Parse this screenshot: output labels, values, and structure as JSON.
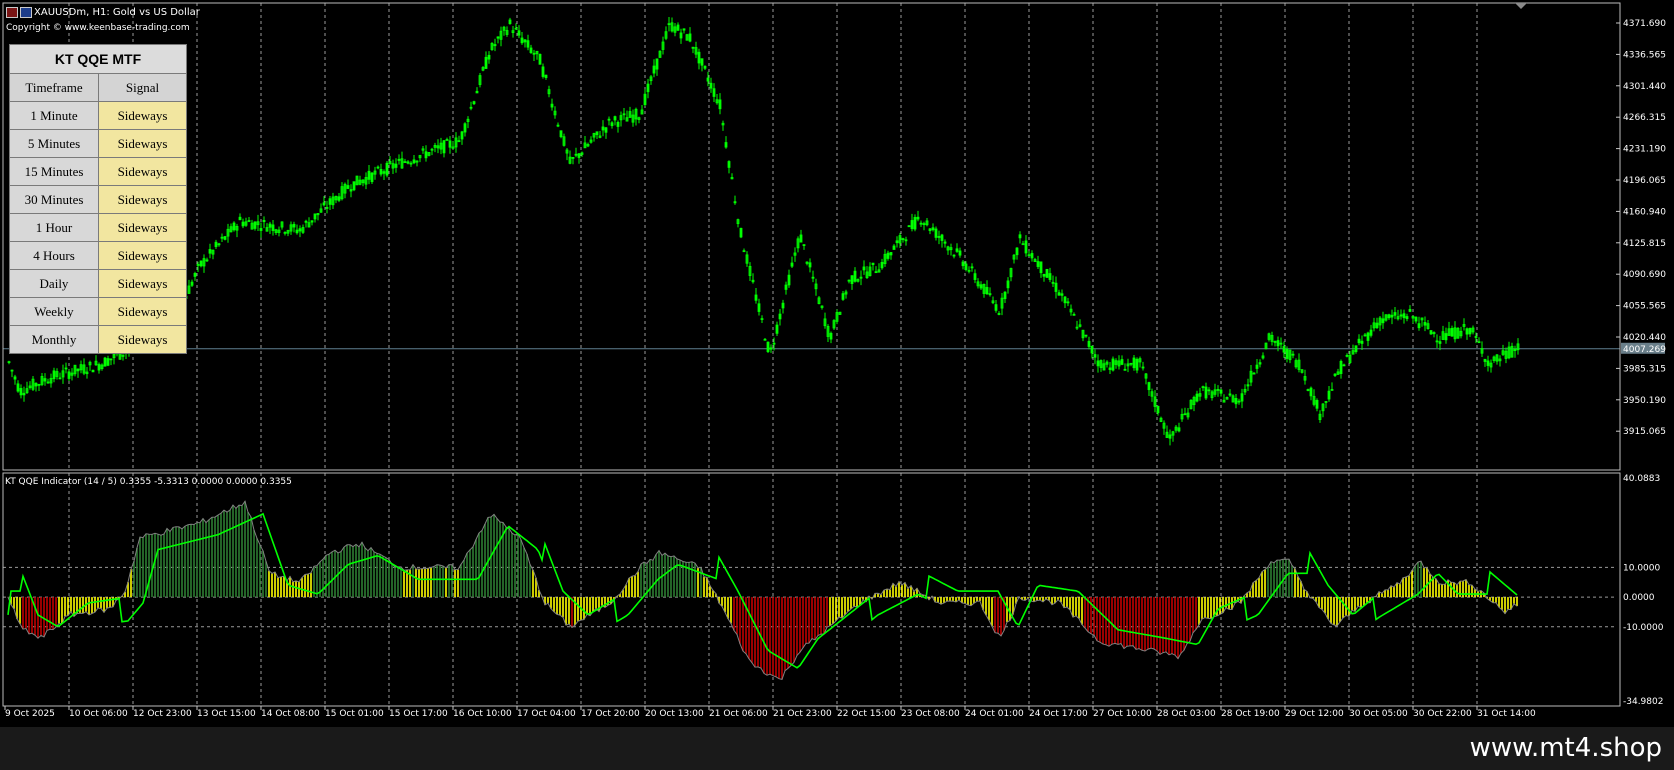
{
  "window": {
    "symbol_title": "XAUUSDm, H1:  Gold vs US Dollar",
    "copyright": "Copyright © www.keenbase-trading.com"
  },
  "mtf_table": {
    "title": "KT QQE MTF",
    "col_timeframe": "Timeframe",
    "col_signal": "Signal",
    "rows": [
      {
        "timeframe": "1 Minute",
        "signal": "Sideways"
      },
      {
        "timeframe": "5 Minutes",
        "signal": "Sideways"
      },
      {
        "timeframe": "15 Minutes",
        "signal": "Sideways"
      },
      {
        "timeframe": "30 Minutes",
        "signal": "Sideways"
      },
      {
        "timeframe": "1 Hour",
        "signal": "Sideways"
      },
      {
        "timeframe": "4 Hours",
        "signal": "Sideways"
      },
      {
        "timeframe": "Daily",
        "signal": "Sideways"
      },
      {
        "timeframe": "Weekly",
        "signal": "Sideways"
      },
      {
        "timeframe": "Monthly",
        "signal": "Sideways"
      }
    ]
  },
  "price_axis": {
    "labels": [
      "4371.690",
      "4336.565",
      "4301.440",
      "4266.315",
      "4231.190",
      "4196.065",
      "4160.940",
      "4125.815",
      "4090.690",
      "4055.565",
      "4020.440",
      "3985.315",
      "3950.190",
      "3915.065"
    ],
    "current_price": "4007.269"
  },
  "indicator": {
    "label": "KT QQE Indicator (14 / 5) 0.3355 -5.3313 0.0000 0.0000 0.3355",
    "axis_labels": [
      "40.0883",
      "10.0000",
      "0.0000",
      "-10.0000",
      "-34.9802"
    ]
  },
  "time_axis": {
    "labels": [
      "9 Oct 2025",
      "10 Oct 06:00",
      "12 Oct 23:00",
      "13 Oct 15:00",
      "14 Oct 08:00",
      "15 Oct 01:00",
      "15 Oct 17:00",
      "16 Oct 10:00",
      "17 Oct 04:00",
      "17 Oct 20:00",
      "20 Oct 13:00",
      "21 Oct 06:00",
      "21 Oct 23:00",
      "22 Oct 15:00",
      "23 Oct 08:00",
      "24 Oct 01:00",
      "24 Oct 17:00",
      "27 Oct 10:00",
      "28 Oct 03:00",
      "28 Oct 19:00",
      "29 Oct 12:00",
      "30 Oct 05:00",
      "30 Oct 22:00",
      "31 Oct 14:00"
    ]
  },
  "colors": {
    "candles": "#00ff00",
    "grid": "#9a9a9a",
    "qqe_line": "#00ff00",
    "hist_bull": "#2e7d32",
    "hist_neutral": "#ffff00",
    "hist_bear": "#c00000",
    "rsi_line": "#808080",
    "price_line": "#5f7f8f"
  },
  "footer": {
    "url": "www.mt4.shop"
  }
}
